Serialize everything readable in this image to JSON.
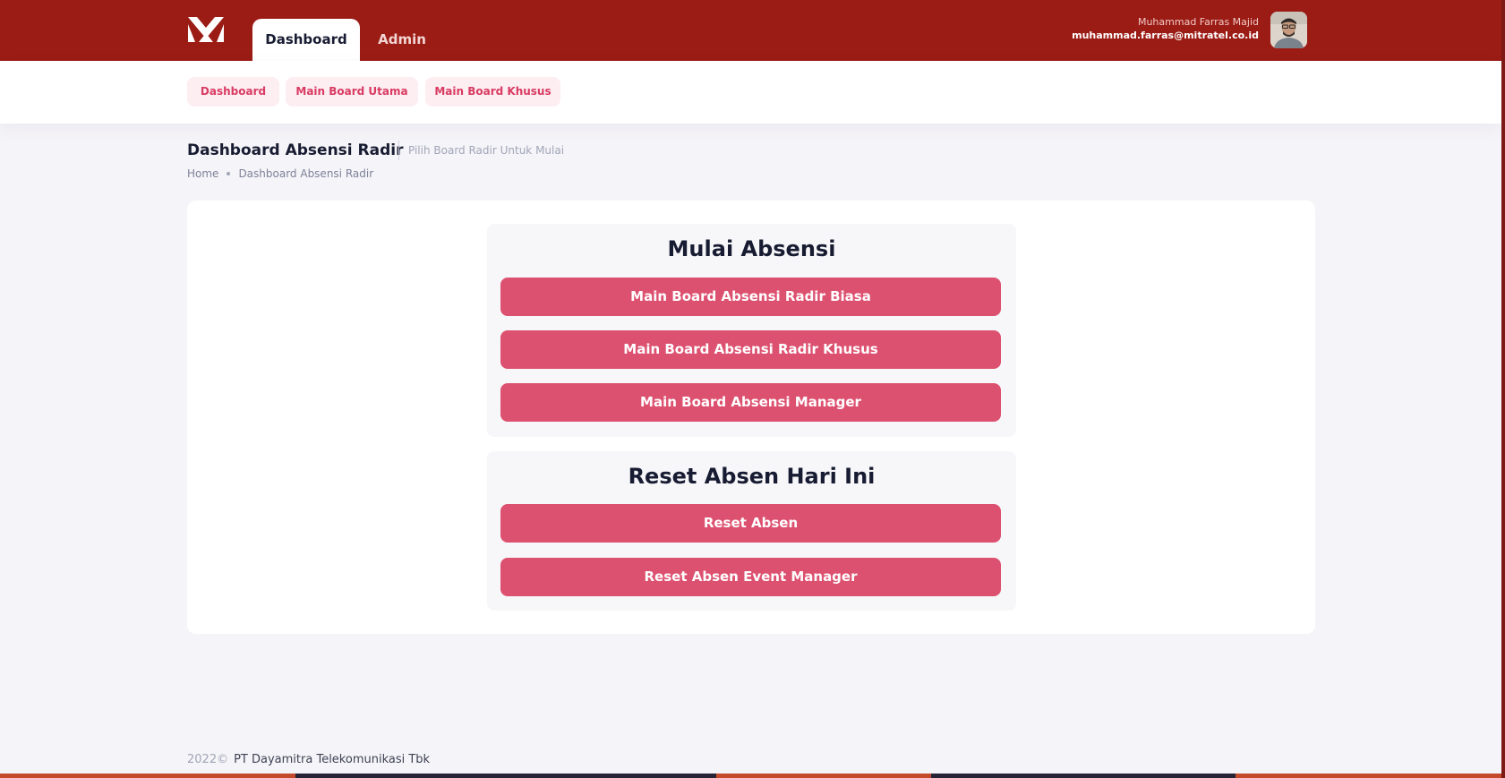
{
  "header": {
    "tabs": [
      {
        "label": "Dashboard",
        "active": true
      },
      {
        "label": "Admin",
        "active": false
      }
    ],
    "user": {
      "name": "Muhammad Farras Majid",
      "email": "muhammad.farras@mitratel.co.id"
    },
    "brand_color": "#9b1c15"
  },
  "subnav": {
    "items": [
      {
        "label": "Dashboard"
      },
      {
        "label": "Main Board Utama"
      },
      {
        "label": "Main Board Khusus"
      }
    ]
  },
  "page": {
    "title": "Dashboard Absensi Radir",
    "subtitle": "Pilih Board Radir Untuk Mulai",
    "breadcrumb": [
      "Home",
      "Dashboard Absensi Radir"
    ]
  },
  "sections": [
    {
      "heading": "Mulai Absensi",
      "buttons": [
        {
          "label": "Main Board Absensi Radir Biasa"
        },
        {
          "label": "Main Board Absensi Radir Khusus"
        },
        {
          "label": "Main Board Absensi Manager"
        }
      ]
    },
    {
      "heading": "Reset Absen Hari Ini",
      "buttons": [
        {
          "label": "Reset Absen"
        },
        {
          "label": "Reset Absen Event Manager"
        }
      ]
    }
  ],
  "footer": {
    "year": "2022©",
    "company": "PT Dayamitra Telekomunikasi Tbk"
  },
  "colors": {
    "accent_button": "#dd5170",
    "pill_text": "#d93b62",
    "pill_bg": "#fdeef2"
  },
  "icons": {
    "logo": "mitratel-logo-icon",
    "avatar": "user-avatar-icon"
  }
}
